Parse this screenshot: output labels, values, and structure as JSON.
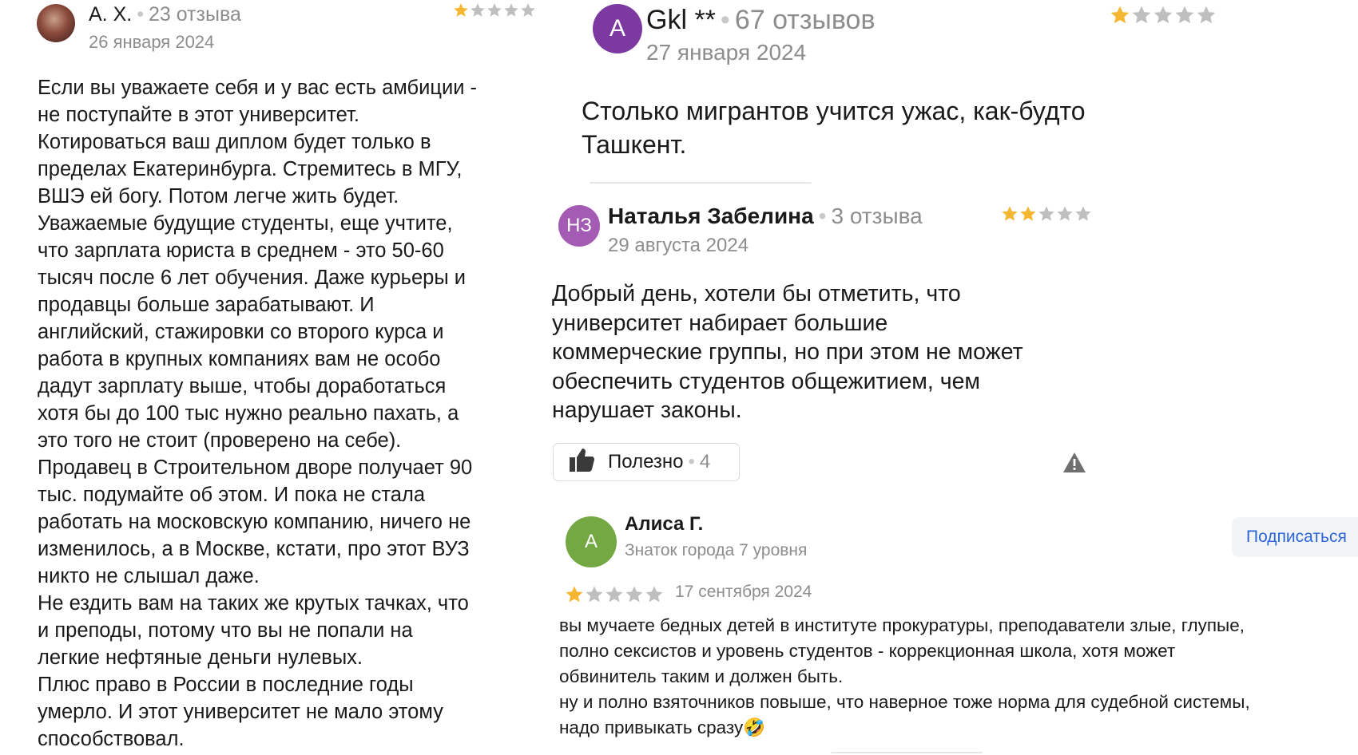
{
  "colors": {
    "star_filled": "#f5b731",
    "star_empty": "#bfbfbf",
    "avatar_gkl": "#7c3aa0",
    "avatar_nz": "#a45bb3",
    "avatar_alisa": "#74a843",
    "link": "#2a66d8"
  },
  "reviews": [
    {
      "author": "А. Х.",
      "reviews_count": "23 отзыва",
      "date": "26 января 2024",
      "rating": 1,
      "text": "Если вы уважаете себя и у вас есть амбиции -\nне поступайте в этот университет.\nКотироваться ваш диплом будет только в\nпределах Екатеринбурга. Стремитесь в МГУ,\nВШЭ ей богу. Потом легче жить будет.\nУважаемые будущие студенты, еще учтите,\nчто зарплата юриста в среднем - это 50-60\nтысяч после 6 лет обучения. Даже курьеры и\nпродавцы больше зарабатывают. И\nанглийский, стажировки со второго курса и\nработа в крупных компаниях вам не особо\nдадут зарплату выше, чтобы доработаться\nхотя бы до 100 тыс нужно реально пахать, а\nэто того не стоит (проверено на себе).\nПродавец в Строительном дворе получает 90\nтыс. подумайте об этом. И пока не стала\nработать на московскую компанию, ничего не\nизменилось, а в Москве, кстати, про этот ВУЗ\nникто не слышал даже.\nНе ездить вам на таких же крутых тачках, что\nи преподы, потому что вы не попали на\nлегкие нефтяные деньги нулевых.\nПлюс право в России в последние годы\nумерло. И этот университет не мало этому\nспособствовал."
    },
    {
      "avatar_letter": "A",
      "author": "Gkl **",
      "reviews_count": "67 отзывов",
      "date": "27 января 2024",
      "rating": 1,
      "text": "Столько мигрантов учится ужас, как-будто\nТашкент."
    },
    {
      "avatar_letter": "НЗ",
      "author": "Наталья Забелина",
      "reviews_count": "3 отзыва",
      "date": "29 августа 2024",
      "rating": 2,
      "text": "Добрый день, хотели бы отметить, что\nуниверситет набирает большие\nкоммерческие группы, но при этом не может\nобеспечить студентов общежитием, чем\nнарушает законы.",
      "useful_label": "Полезно",
      "useful_count": "4"
    },
    {
      "avatar_letter": "А",
      "author": "Алиса Г.",
      "level": "Знаток города 7 уровня",
      "subscribe_label": "Подписаться",
      "date": "17 сентября 2024",
      "rating": 1,
      "text": "вы мучаете бедных детей в институте прокуратуры, преподаватели злые, глупые,\nполно сексистов и уровень студентов - коррекционная школа, хотя может\nобвинитель таким и должен быть.\nну и полно взяточников повыше, что наверное тоже норма для судебной системы,\nнадо привыкать сразу🤣"
    }
  ]
}
